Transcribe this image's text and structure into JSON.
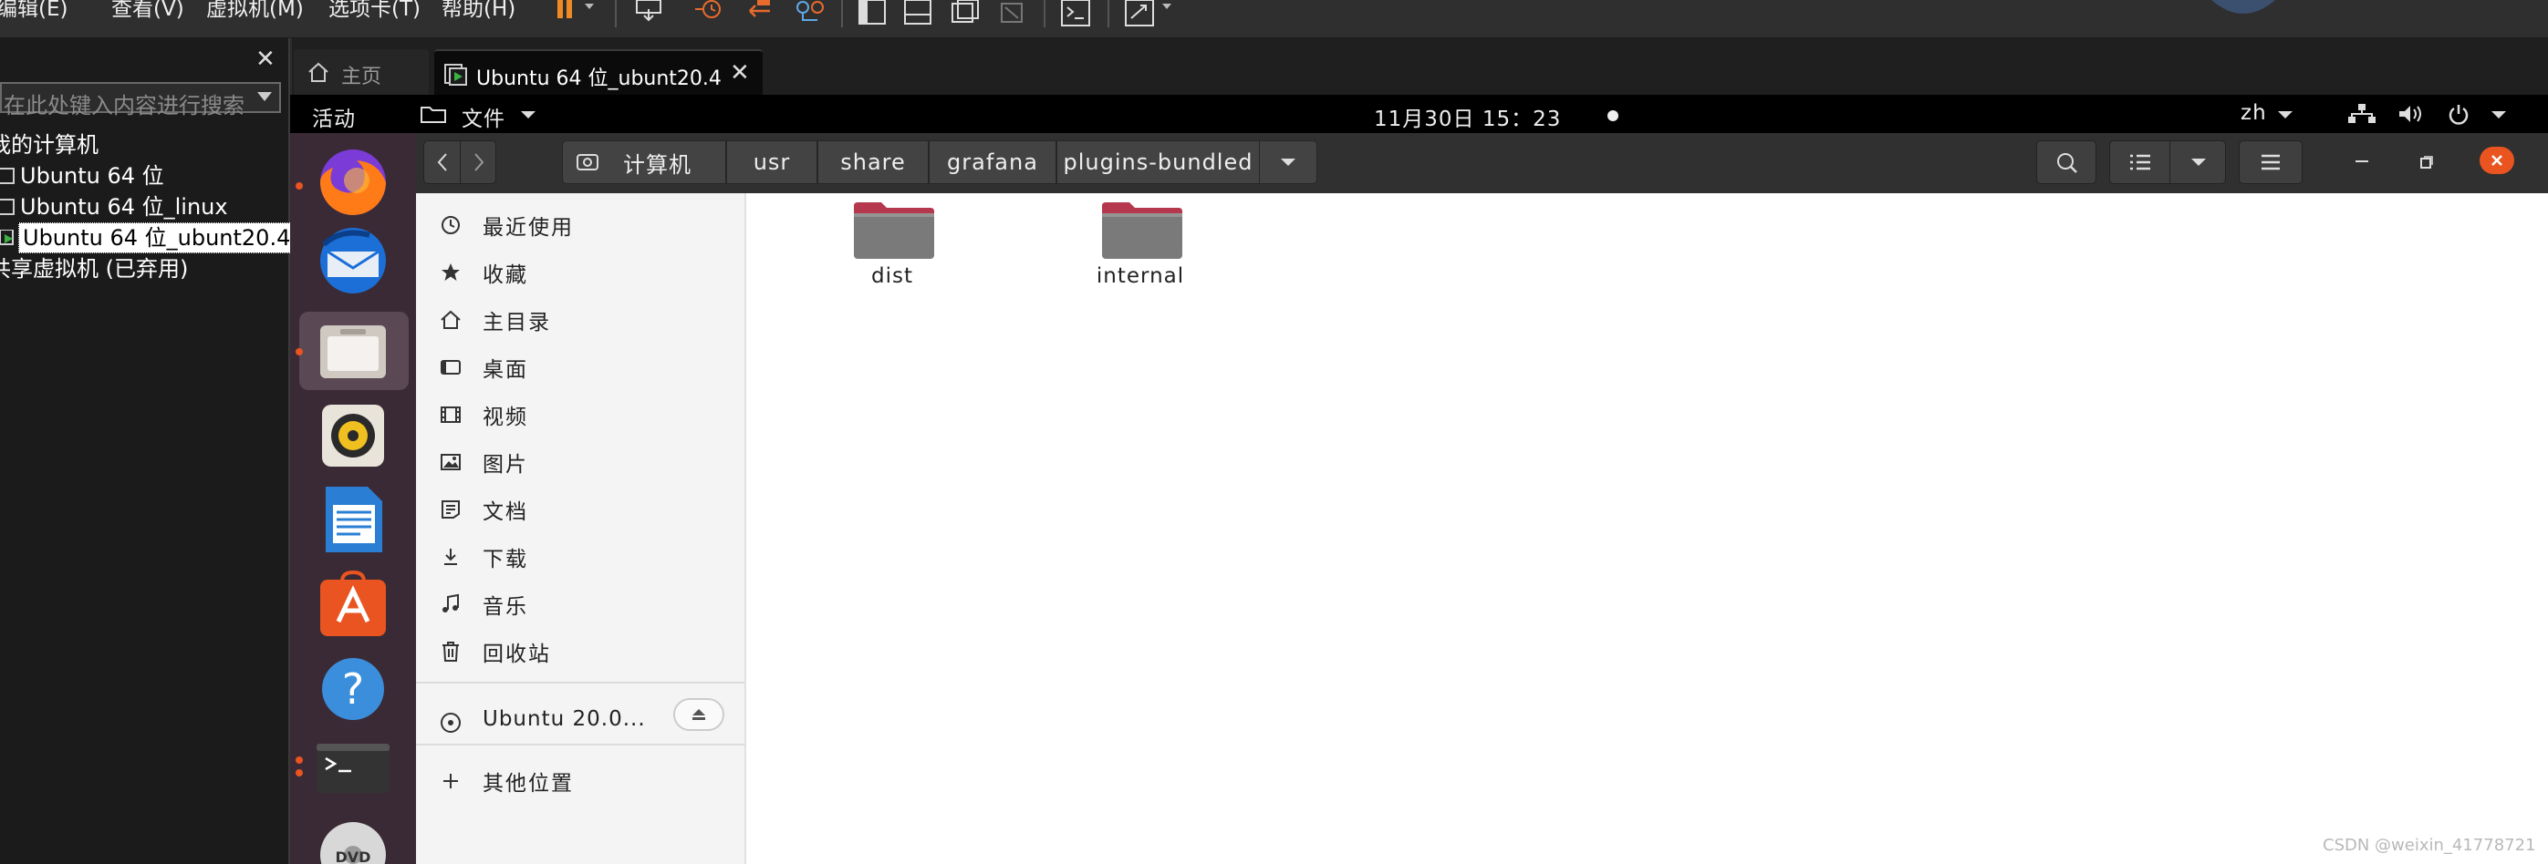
{
  "vmware": {
    "menu": {
      "edit": "编辑(E)",
      "view": "查看(V)",
      "vm": "虚拟机(M)",
      "tabs": "选项卡(T)",
      "help": "帮助(H)"
    },
    "library": {
      "search_placeholder": "在此处键入内容进行搜索",
      "tree": {
        "root": "我的计算机",
        "vm1": "Ubuntu 64 位",
        "vm2": "Ubuntu 64 位_linux",
        "vm3": "Ubuntu 64 位_ubunt20.4",
        "shared": "共享虚拟机 (已弃用)"
      }
    },
    "tabs": {
      "home": "主页",
      "vm": "Ubuntu 64 位_ubunt20.4"
    }
  },
  "guest": {
    "topbar": {
      "activities": "活动",
      "files_menu": "文件",
      "clock": "11月30日  15：23",
      "lang": "zh"
    },
    "nautilus": {
      "breadcrumb": [
        "计算机",
        "usr",
        "share",
        "grafana",
        "plugins-bundled"
      ],
      "sidebar": {
        "recent": "最近使用",
        "starred": "收藏",
        "home": "主目录",
        "desktop": "桌面",
        "videos": "视频",
        "pictures": "图片",
        "documents": "文档",
        "downloads": "下载",
        "music": "音乐",
        "trash": "回收站",
        "device": "Ubuntu 20.0...",
        "other": "其他位置"
      },
      "folders": [
        "dist",
        "internal"
      ]
    }
  },
  "watermark": "CSDN @weixin_41778721",
  "colors": {
    "accent": "#e95420",
    "dock": "#3a2a35",
    "folder_top": "#b5384e",
    "folder_body": "#7a7a7a"
  }
}
